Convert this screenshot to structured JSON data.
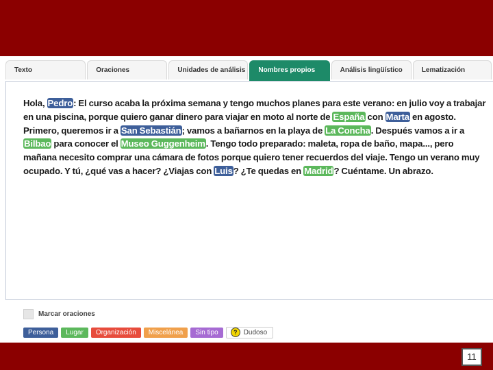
{
  "tabs": [
    {
      "label": "Texto"
    },
    {
      "label": "Oraciones"
    },
    {
      "label": "Unidades de análisis"
    },
    {
      "label": "Nombres propios"
    },
    {
      "label": "Análisis lingüístico"
    },
    {
      "label": "Lematización"
    }
  ],
  "active_tab": "Nombres propios",
  "text_segments": [
    {
      "t": "Hola, "
    },
    {
      "t": "Pedro",
      "type": "persona"
    },
    {
      "t": ": El curso acaba la próxima semana y tengo muchos planes para este verano: en julio voy a trabajar en una piscina, porque quiero ganar dinero para viajar en moto al norte de "
    },
    {
      "t": "España",
      "type": "lugar"
    },
    {
      "t": " con "
    },
    {
      "t": "Marta",
      "type": "persona"
    },
    {
      "t": " en agosto. Primero, queremos ir a "
    },
    {
      "t": "San Sebastián",
      "type": "persona"
    },
    {
      "t": "; vamos a bañarnos en la playa de "
    },
    {
      "t": "La Concha",
      "type": "lugar"
    },
    {
      "t": ". Después vamos a ir a "
    },
    {
      "t": "Bilbao",
      "type": "lugar"
    },
    {
      "t": " para conocer el "
    },
    {
      "t": "Museo Guggenheim",
      "type": "lugar"
    },
    {
      "t": ". Tengo todo preparado: maleta, ropa de baño, mapa..., pero mañana necesito comprar una cámara de fotos porque quiero tener recuerdos del viaje. Tengo un verano muy ocupado. Y tú, ¿qué vas a hacer? ¿Viajas con "
    },
    {
      "t": "Luis",
      "type": "persona"
    },
    {
      "t": "? ¿Te quedas en "
    },
    {
      "t": "Madrid",
      "type": "lugar"
    },
    {
      "t": "? Cuéntame. Un abrazo."
    }
  ],
  "mark_sentences_label": "Marcar oraciones",
  "legend": [
    {
      "label": "Persona",
      "color": "#3e5f9a"
    },
    {
      "label": "Lugar",
      "color": "#5cb85c"
    },
    {
      "label": "Organización",
      "color": "#e74c3c"
    },
    {
      "label": "Miscelánea",
      "color": "#f0a04b"
    },
    {
      "label": "Sin tipo",
      "color": "#a66bd3"
    }
  ],
  "dudoso": {
    "label": "Dudoso",
    "icon": "?"
  },
  "page_number": "11",
  "colors": {
    "header_bg": "#8b0000",
    "active_tab": "#1d8a68"
  }
}
